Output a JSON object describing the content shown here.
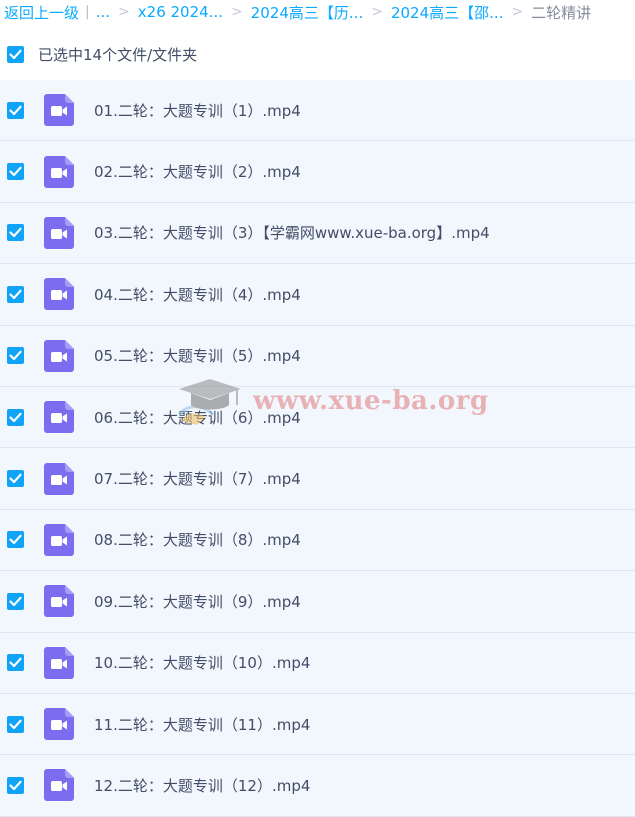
{
  "breadcrumb": {
    "back": "返回上一级",
    "separator": "|",
    "more": "...",
    "chevron": ">",
    "crumbs": [
      "x26 2024...",
      "2024高三【历...",
      "2024高三【邵..."
    ],
    "current": "二轮精讲"
  },
  "selection": {
    "checked": true,
    "label": "已选中14个文件/文件夹"
  },
  "files": [
    {
      "name": "01.二轮：大题专训（1）.mp4",
      "checked": true,
      "type": "video"
    },
    {
      "name": "02.二轮：大题专训（2）.mp4",
      "checked": true,
      "type": "video"
    },
    {
      "name": "03.二轮：大题专训（3）【学霸网www.xue-ba.org】.mp4",
      "checked": true,
      "type": "video"
    },
    {
      "name": "04.二轮：大题专训（4）.mp4",
      "checked": true,
      "type": "video"
    },
    {
      "name": "05.二轮：大题专训（5）.mp4",
      "checked": true,
      "type": "video"
    },
    {
      "name": "06.二轮：大题专训（6）.mp4",
      "checked": true,
      "type": "video"
    },
    {
      "name": "07.二轮：大题专训（7）.mp4",
      "checked": true,
      "type": "video"
    },
    {
      "name": "08.二轮：大题专训（8）.mp4",
      "checked": true,
      "type": "video"
    },
    {
      "name": "09.二轮：大题专训（9）.mp4",
      "checked": true,
      "type": "video"
    },
    {
      "name": "10.二轮：大题专训（10）.mp4",
      "checked": true,
      "type": "video"
    },
    {
      "name": "11.二轮：大题专训（11）.mp4",
      "checked": true,
      "type": "video"
    },
    {
      "name": "12.二轮：大题专训（12）.mp4",
      "checked": true,
      "type": "video"
    }
  ],
  "watermark": {
    "text": "www.xue-ba.org"
  },
  "colors": {
    "link": "#09aaff",
    "checkbox": "#0fa4f8",
    "video_icon": "#7b6cf0",
    "row_bg": "#f2f6fd"
  },
  "icons": {
    "checkbox": "check-icon",
    "file": "video-file-icon",
    "watermark": "graduation-cap-icon"
  }
}
